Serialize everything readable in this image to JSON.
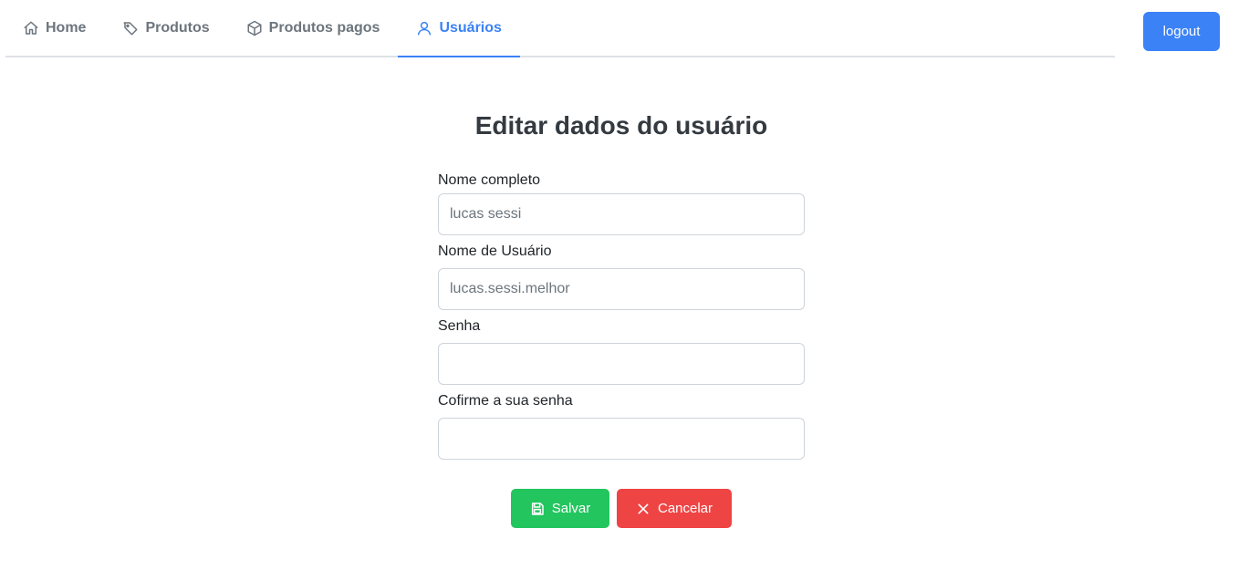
{
  "nav": {
    "tabs": [
      {
        "label": "Home",
        "icon": "home-icon",
        "active": false
      },
      {
        "label": "Produtos",
        "icon": "tag-icon",
        "active": false
      },
      {
        "label": "Produtos pagos",
        "icon": "box-icon",
        "active": false
      },
      {
        "label": "Usuários",
        "icon": "user-icon",
        "active": true
      }
    ],
    "logout_label": "logout"
  },
  "page": {
    "title": "Editar dados do usuário"
  },
  "form": {
    "fields": [
      {
        "label": "Nome completo",
        "value": "lucas sessi",
        "placeholder": ""
      },
      {
        "label": "Nome de Usuário",
        "value": "lucas.sessi.melhor",
        "placeholder": ""
      },
      {
        "label": "Senha",
        "value": "",
        "placeholder": ""
      },
      {
        "label": "Cofirme a sua senha",
        "value": "",
        "placeholder": ""
      }
    ],
    "save_label": "Salvar",
    "cancel_label": "Cancelar"
  },
  "colors": {
    "accent": "#3b82f6",
    "save": "#22c55e",
    "cancel": "#ef4444",
    "tab_inactive": "#6c757d"
  }
}
